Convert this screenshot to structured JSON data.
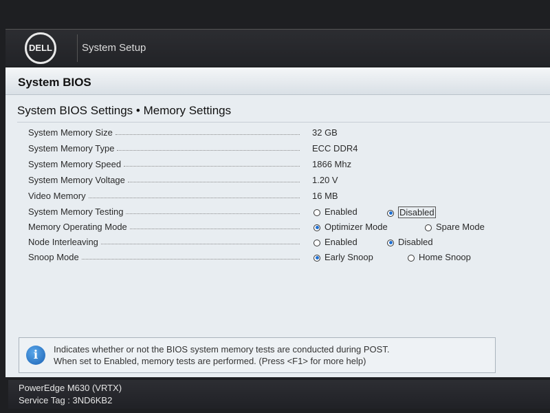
{
  "header": {
    "logo_text": "DELL",
    "title": "System Setup"
  },
  "section": {
    "title": "System BIOS"
  },
  "page": {
    "title": "System BIOS Settings • Memory Settings"
  },
  "settings": [
    {
      "label": "System Memory Size",
      "value": "32 GB"
    },
    {
      "label": "System Memory Type",
      "value": "ECC DDR4"
    },
    {
      "label": "System Memory Speed",
      "value": "1866 Mhz"
    },
    {
      "label": "System Memory Voltage",
      "value": "1.20 V"
    },
    {
      "label": "Video Memory",
      "value": "16 MB"
    },
    {
      "label": "System Memory Testing",
      "options": [
        "Enabled",
        "Disabled"
      ],
      "selected": "Disabled"
    },
    {
      "label": "Memory Operating Mode",
      "options": [
        "Optimizer Mode",
        "Spare Mode"
      ],
      "selected": "Optimizer Mode"
    },
    {
      "label": "Node Interleaving",
      "options": [
        "Enabled",
        "Disabled"
      ],
      "selected": "Disabled"
    },
    {
      "label": "Snoop Mode",
      "options": [
        "Early Snoop",
        "Home Snoop"
      ],
      "selected": "Early Snoop"
    }
  ],
  "help": {
    "icon": "info-icon",
    "line1": "Indicates whether or not the BIOS system memory tests are conducted during POST.",
    "line2": "When set to Enabled, memory tests are performed. (Press <F1> for more help)"
  },
  "footer": {
    "model": "PowerEdge M630 (VRTX)",
    "service_tag": "Service Tag : 3ND6KB2"
  },
  "colors": {
    "accent": "#1f6fd1",
    "panel": "#e8edf1",
    "bar": "#222327"
  }
}
